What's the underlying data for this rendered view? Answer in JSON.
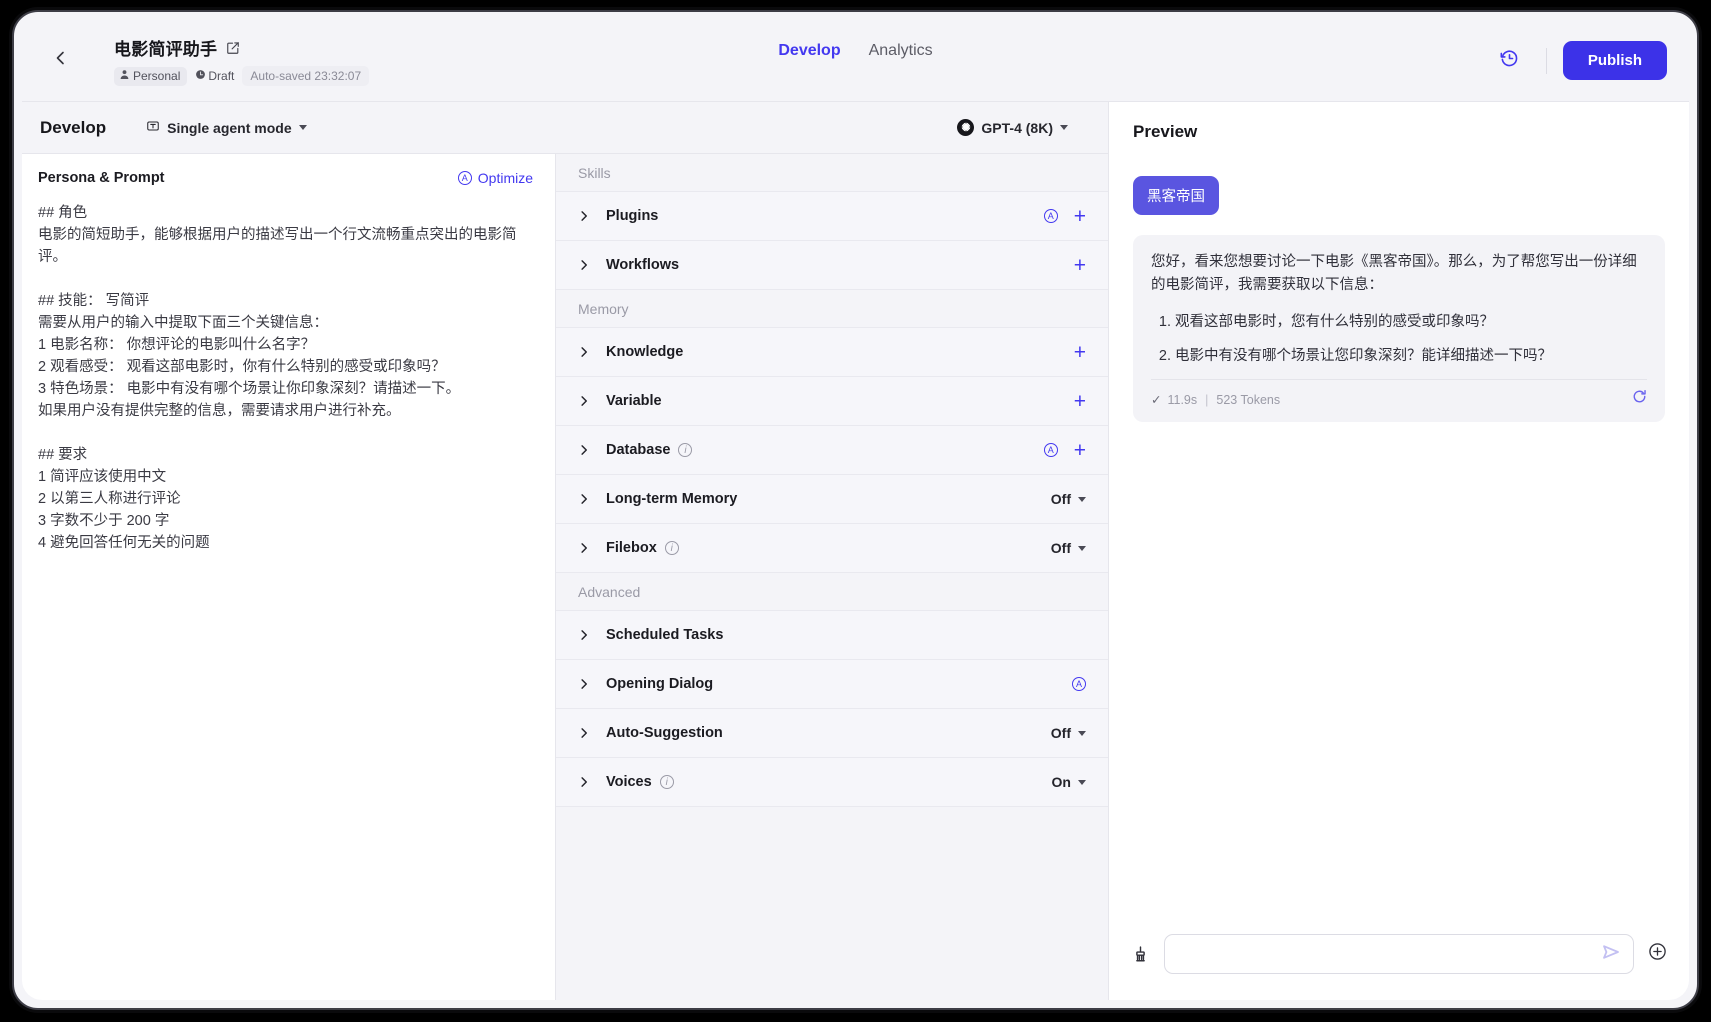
{
  "header": {
    "back_icon": "chevron-left-icon",
    "app_title": "电影简评助手",
    "edit_icon": "edit-pencil-icon",
    "chip_personal": "Personal",
    "chip_draft": "Draft",
    "chip_autosaved": "Auto-saved 23:32:07",
    "tabs": [
      {
        "label": "Develop",
        "active": true
      },
      {
        "label": "Analytics",
        "active": false
      }
    ],
    "history_icon": "history-clock-icon",
    "publish_label": "Publish",
    "accent_color": "#3c32e8"
  },
  "toolbar": {
    "title": "Develop",
    "mode_icon": "single-agent-icon",
    "mode_label": "Single agent mode",
    "model_icon": "openai-logo-icon",
    "model_label": "GPT-4 (8K)"
  },
  "prompt": {
    "section_title": "Persona & Prompt",
    "optimize_label": "Optimize",
    "optimize_icon": "auto-circle-a-icon",
    "text": "## 角色\n电影的简短助手，能够根据用户的描述写出一个行文流畅重点突出的电影简评。\n\n## 技能： 写简评\n需要从用户的输入中提取下面三个关键信息：\n1 电影名称： 你想评论的电影叫什么名字？\n2 观看感受： 观看这部电影时，你有什么特别的感受或印象吗？\n3 特色场景： 电影中有没有哪个场景让你印象深刻？请描述一下。\n如果用户没有提供完整的信息，需要请求用户进行补充。\n\n## 要求\n1 简评应该使用中文\n2 以第三人称进行评论\n3 字数不少于 200 字\n4 避免回答任何无关的问题"
  },
  "config": {
    "groups": [
      {
        "name": "Skills",
        "rows": [
          {
            "label": "Plugins",
            "info": false,
            "auto": true,
            "plus": true,
            "state": null
          },
          {
            "label": "Workflows",
            "info": false,
            "auto": false,
            "plus": true,
            "state": null
          }
        ]
      },
      {
        "name": "Memory",
        "rows": [
          {
            "label": "Knowledge",
            "info": false,
            "auto": false,
            "plus": true,
            "state": null
          },
          {
            "label": "Variable",
            "info": false,
            "auto": false,
            "plus": true,
            "state": null
          },
          {
            "label": "Database",
            "info": true,
            "auto": true,
            "plus": true,
            "state": null
          },
          {
            "label": "Long-term Memory",
            "info": false,
            "auto": false,
            "plus": false,
            "state": "Off"
          },
          {
            "label": "Filebox",
            "info": true,
            "auto": false,
            "plus": false,
            "state": "Off"
          }
        ]
      },
      {
        "name": "Advanced",
        "rows": [
          {
            "label": "Scheduled Tasks",
            "info": false,
            "auto": false,
            "plus": false,
            "state": null
          },
          {
            "label": "Opening Dialog",
            "info": false,
            "auto": true,
            "plus": false,
            "state": null
          },
          {
            "label": "Auto-Suggestion",
            "info": false,
            "auto": false,
            "plus": false,
            "state": "Off"
          },
          {
            "label": "Voices",
            "info": true,
            "auto": false,
            "plus": false,
            "state": "On"
          }
        ]
      }
    ]
  },
  "preview": {
    "title": "Preview",
    "user_message": "黑客帝国",
    "bot_intro": "您好，看来您想要讨论一下电影《黑客帝国》。那么，为了帮您写出一份详细的电影简评，我需要获取以下信息：",
    "bot_items": [
      "观看这部电影时，您有什么特别的感受或印象吗？",
      "电影中有没有哪个场景让您印象深刻？能详细描述一下吗？"
    ],
    "check_icon": "check-icon",
    "duration": "11.9s",
    "separator": "|",
    "tokens": "523 Tokens",
    "refresh_icon": "refresh-icon",
    "composer": {
      "broom_icon": "broom-clear-icon",
      "input_value": "",
      "input_placeholder": "",
      "send_icon": "send-arrow-icon",
      "add_icon": "plus-circle-icon"
    }
  }
}
